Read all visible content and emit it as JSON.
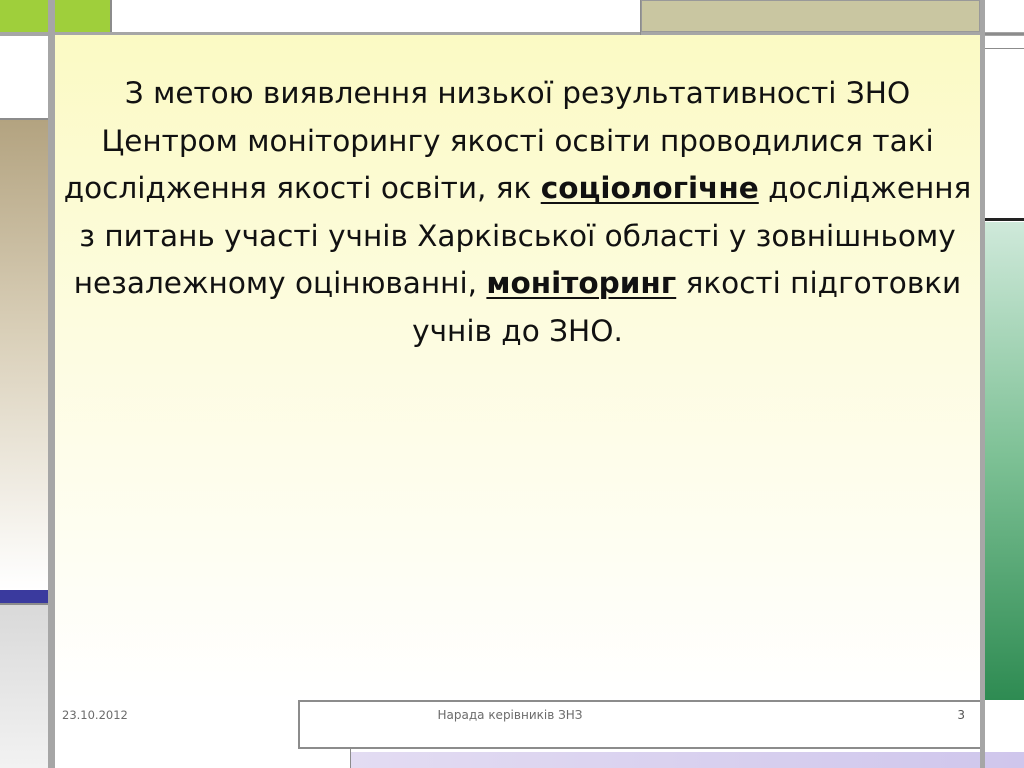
{
  "slide": {
    "text_before_1": "З метою виявлення низької результативності ЗНО Центром моніторингу якості освіти проводилися такі дослідження якості освіти, як ",
    "emphasis_1": "соціологічне",
    "text_between": " дослідження з питань участі учнів Харківської області у зовнішньому незалежному оцінюванні, ",
    "emphasis_2": "моніторинг",
    "text_after": " якості підготовки учнів до ЗНО."
  },
  "footer": {
    "date": "23.10.2012",
    "title": "Нарада керівників ЗНЗ",
    "page_number": "3"
  },
  "colors": {
    "lime_accent": "#c3dc5c",
    "olive_block": "#c9c6a1",
    "tan_block": "#b3a380",
    "navy_accent": "#3a3a9e",
    "green_block": "#3d9a5a",
    "panel_top": "#fbfac4"
  }
}
